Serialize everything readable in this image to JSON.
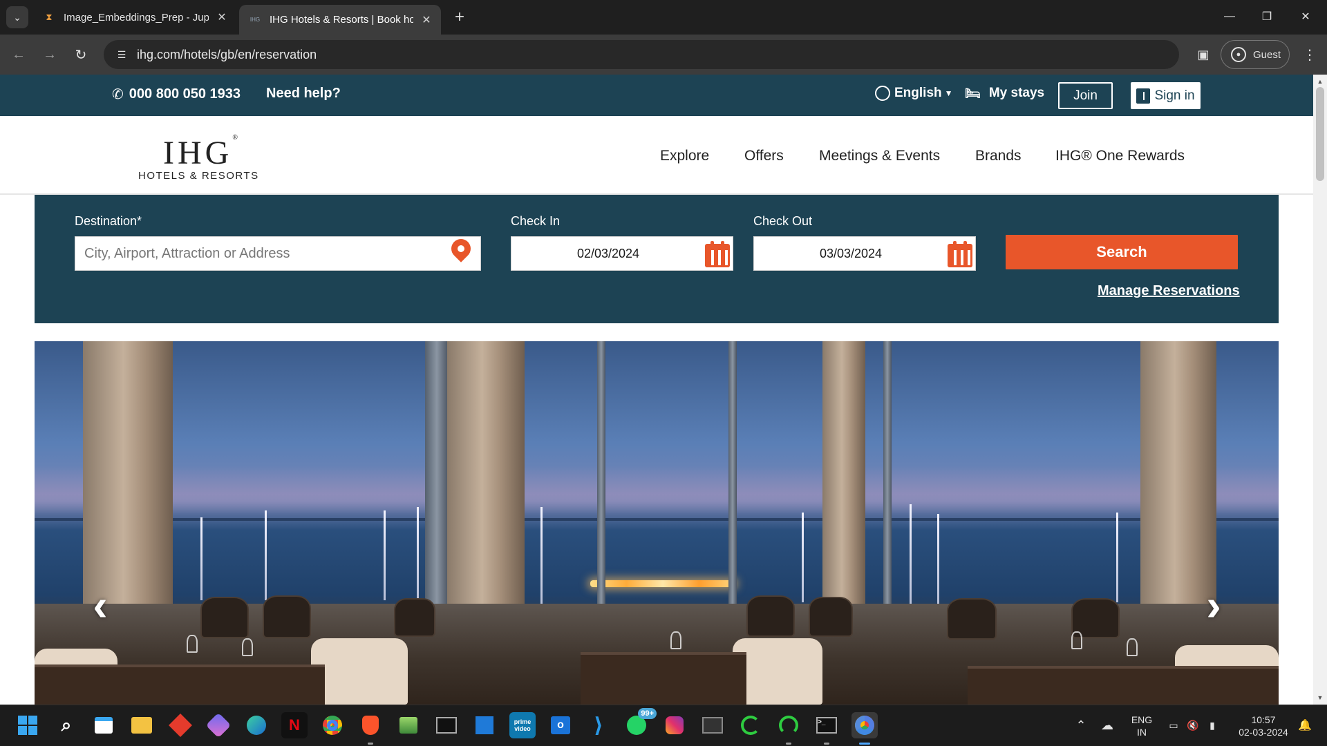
{
  "browser": {
    "tabs": [
      {
        "title": "Image_Embeddings_Prep - Jupyter",
        "active": false
      },
      {
        "title": "IHG Hotels & Resorts | Book hotels",
        "active": true
      }
    ],
    "url": "ihg.com/hotels/gb/en/reservation",
    "profile_label": "Guest"
  },
  "utility_bar": {
    "phone": "000 800 050 1933",
    "help": "Need help?",
    "language": "English",
    "my_stays": "My stays",
    "join": "Join",
    "sign_in": "Sign in"
  },
  "logo": {
    "word": "IHG",
    "reg": "®",
    "subtitle": "HOTELS & RESORTS"
  },
  "nav": [
    "Explore",
    "Offers",
    "Meetings & Events",
    "Brands",
    "IHG® One Rewards"
  ],
  "booking": {
    "destination_label": "Destination*",
    "destination_placeholder": "City, Airport, Attraction or Address",
    "checkin_label": "Check In",
    "checkin_value": "02/03/2024",
    "checkout_label": "Check Out",
    "checkout_value": "03/03/2024",
    "search": "Search",
    "manage": "Manage Reservations"
  },
  "hero": {
    "prev_arrow": "‹",
    "next_arrow": "›"
  },
  "taskbar": {
    "whatsapp_badge": "99+",
    "language_top": "ENG",
    "language_bottom": "IN",
    "time": "10:57",
    "date": "02-03-2024"
  },
  "colors": {
    "brand_navy": "#1d4354",
    "accent_orange": "#e8562a"
  }
}
